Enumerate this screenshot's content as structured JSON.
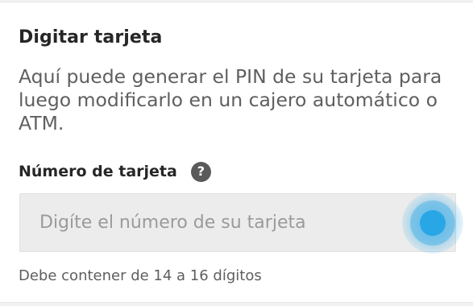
{
  "card": {
    "title": "Digitar tarjeta",
    "description": "Aquí puede generar el PIN de su tarjeta para luego modificarlo en un cajero automático o ATM."
  },
  "field": {
    "label": "Número de tarjeta",
    "help_icon": "question-icon",
    "help_glyph": "?",
    "value": "",
    "placeholder": "Digíte el número de su tarjeta",
    "hint": "Debe contener de 14 a 16 dígitos"
  },
  "colors": {
    "focus_indicator": "#29a6e6",
    "input_background": "#ececec",
    "help_icon_background": "#5a5a5a"
  }
}
